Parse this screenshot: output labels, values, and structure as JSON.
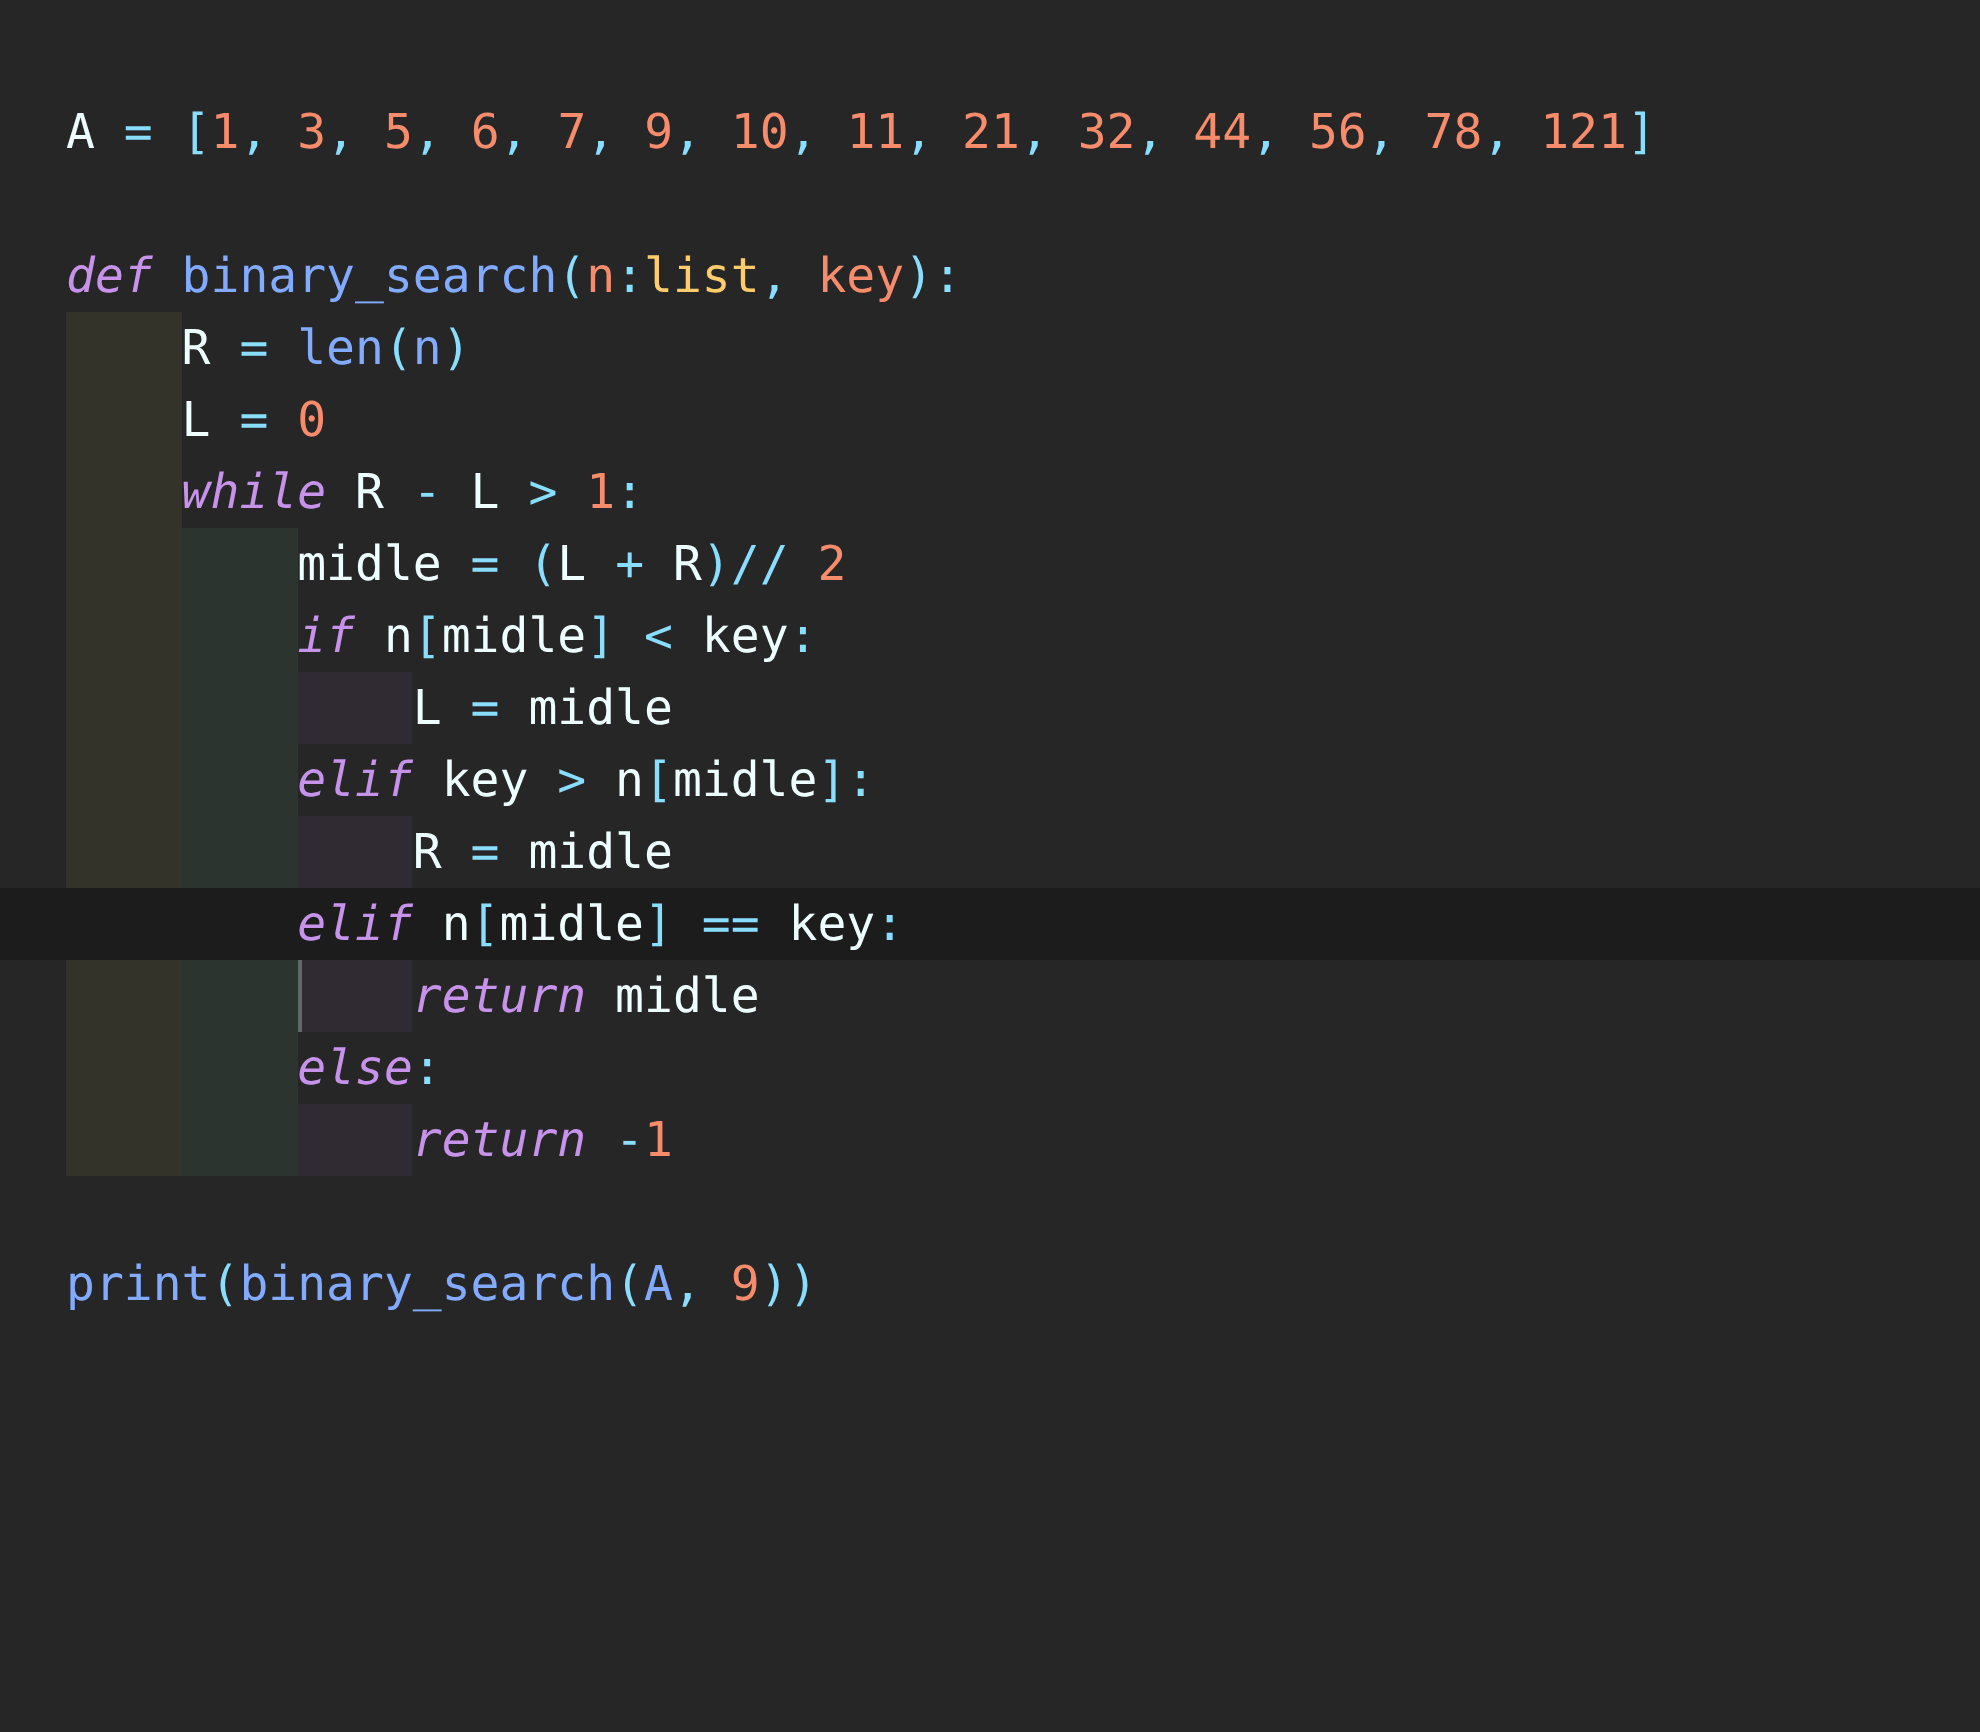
{
  "editor": {
    "lines": [
      {
        "kind": "code",
        "tokens": [
          {
            "t": "A",
            "kind": "plain"
          },
          {
            "t": " = ",
            "kind": "punc"
          },
          {
            "t": "[",
            "kind": "punc"
          },
          {
            "t": "1",
            "kind": "num"
          },
          {
            "t": ", ",
            "kind": "punc"
          },
          {
            "t": "3",
            "kind": "num"
          },
          {
            "t": ", ",
            "kind": "punc"
          },
          {
            "t": "5",
            "kind": "num"
          },
          {
            "t": ", ",
            "kind": "punc"
          },
          {
            "t": "6",
            "kind": "num"
          },
          {
            "t": ", ",
            "kind": "punc"
          },
          {
            "t": "7",
            "kind": "num"
          },
          {
            "t": ", ",
            "kind": "punc"
          },
          {
            "t": "9",
            "kind": "num"
          },
          {
            "t": ", ",
            "kind": "punc"
          },
          {
            "t": "10",
            "kind": "num"
          },
          {
            "t": ", ",
            "kind": "punc"
          },
          {
            "t": "11",
            "kind": "num"
          },
          {
            "t": ", ",
            "kind": "punc"
          },
          {
            "t": "21",
            "kind": "num"
          },
          {
            "t": ", ",
            "kind": "punc"
          },
          {
            "t": "32",
            "kind": "num"
          },
          {
            "t": ", ",
            "kind": "punc"
          },
          {
            "t": "44",
            "kind": "num"
          },
          {
            "t": ", ",
            "kind": "punc"
          },
          {
            "t": "56",
            "kind": "num"
          },
          {
            "t": ", ",
            "kind": "punc"
          },
          {
            "t": "78",
            "kind": "num"
          },
          {
            "t": ", ",
            "kind": "punc"
          },
          {
            "t": "121",
            "kind": "num"
          },
          {
            "t": "]",
            "kind": "punc"
          }
        ]
      },
      {
        "kind": "blank"
      },
      {
        "kind": "code",
        "tokens": [
          {
            "t": "def",
            "kind": "kw"
          },
          {
            "t": " binary_search",
            "kind": "fn"
          },
          {
            "t": "(",
            "kind": "punc"
          },
          {
            "t": "n",
            "kind": "param"
          },
          {
            "t": ":",
            "kind": "punc"
          },
          {
            "t": "list",
            "kind": "type"
          },
          {
            "t": ", ",
            "kind": "punc"
          },
          {
            "t": "key",
            "kind": "param"
          },
          {
            "t": "):",
            "kind": "punc"
          }
        ],
        "children": [
          {
            "kind": "code",
            "tokens": [
              {
                "t": "R",
                "kind": "plain"
              },
              {
                "t": " = ",
                "kind": "punc"
              },
              {
                "t": "len",
                "kind": "fn"
              },
              {
                "t": "(",
                "kind": "punc"
              },
              {
                "t": "n",
                "kind": "fn"
              },
              {
                "t": ")",
                "kind": "punc"
              }
            ]
          },
          {
            "kind": "code",
            "tokens": [
              {
                "t": "L",
                "kind": "plain"
              },
              {
                "t": " = ",
                "kind": "punc"
              },
              {
                "t": "0",
                "kind": "num"
              }
            ]
          },
          {
            "kind": "code",
            "tokens": [
              {
                "t": "while",
                "kind": "kw"
              },
              {
                "t": " R ",
                "kind": "plain"
              },
              {
                "t": "-",
                "kind": "punc"
              },
              {
                "t": " L ",
                "kind": "plain"
              },
              {
                "t": "> ",
                "kind": "punc"
              },
              {
                "t": "1",
                "kind": "num"
              },
              {
                "t": ":",
                "kind": "punc"
              }
            ],
            "children": [
              {
                "kind": "code",
                "tokens": [
                  {
                    "t": "midle",
                    "kind": "plain"
                  },
                  {
                    "t": " = ",
                    "kind": "punc"
                  },
                  {
                    "t": "(",
                    "kind": "punc"
                  },
                  {
                    "t": "L ",
                    "kind": "plain"
                  },
                  {
                    "t": "+",
                    "kind": "punc"
                  },
                  {
                    "t": " R",
                    "kind": "plain"
                  },
                  {
                    "t": ")// ",
                    "kind": "punc"
                  },
                  {
                    "t": "2",
                    "kind": "num"
                  }
                ]
              },
              {
                "kind": "code",
                "tokens": [
                  {
                    "t": "if",
                    "kind": "kw"
                  },
                  {
                    "t": " n",
                    "kind": "plain"
                  },
                  {
                    "t": "[",
                    "kind": "punc"
                  },
                  {
                    "t": "midle",
                    "kind": "plain"
                  },
                  {
                    "t": "]",
                    "kind": "punc"
                  },
                  {
                    "t": " < ",
                    "kind": "punc"
                  },
                  {
                    "t": "key",
                    "kind": "plain"
                  },
                  {
                    "t": ":",
                    "kind": "punc"
                  }
                ],
                "children": [
                  {
                    "kind": "code",
                    "tokens": [
                      {
                        "t": "L",
                        "kind": "plain"
                      },
                      {
                        "t": " = ",
                        "kind": "punc"
                      },
                      {
                        "t": "midle",
                        "kind": "plain"
                      }
                    ]
                  }
                ]
              },
              {
                "kind": "code",
                "tokens": [
                  {
                    "t": "elif",
                    "kind": "kw"
                  },
                  {
                    "t": " key ",
                    "kind": "plain"
                  },
                  {
                    "t": ">",
                    "kind": "punc"
                  },
                  {
                    "t": " n",
                    "kind": "plain"
                  },
                  {
                    "t": "[",
                    "kind": "punc"
                  },
                  {
                    "t": "midle",
                    "kind": "plain"
                  },
                  {
                    "t": "]:",
                    "kind": "punc"
                  }
                ],
                "children": [
                  {
                    "kind": "code",
                    "tokens": [
                      {
                        "t": "R",
                        "kind": "plain"
                      },
                      {
                        "t": " = ",
                        "kind": "punc"
                      },
                      {
                        "t": "midle",
                        "kind": "plain"
                      }
                    ]
                  }
                ]
              },
              {
                "kind": "code",
                "current": true,
                "tokens": [
                  {
                    "t": "elif",
                    "kind": "kw"
                  },
                  {
                    "t": " n",
                    "kind": "plain"
                  },
                  {
                    "t": "[",
                    "kind": "punc"
                  },
                  {
                    "t": "midle",
                    "kind": "plain"
                  },
                  {
                    "t": "]",
                    "kind": "punc"
                  },
                  {
                    "t": " == ",
                    "kind": "punc"
                  },
                  {
                    "t": "key",
                    "kind": "plain"
                  },
                  {
                    "t": ":",
                    "kind": "punc"
                  }
                ],
                "children": [
                  {
                    "kind": "code",
                    "tokens": [
                      {
                        "t": "return",
                        "kind": "kw"
                      },
                      {
                        "t": " midle",
                        "kind": "plain"
                      }
                    ]
                  }
                ]
              },
              {
                "kind": "code",
                "tokens": [
                  {
                    "t": "else",
                    "kind": "kw"
                  },
                  {
                    "t": ":",
                    "kind": "punc"
                  }
                ],
                "children": [
                  {
                    "kind": "code",
                    "tokens": [
                      {
                        "t": "return",
                        "kind": "kw"
                      },
                      {
                        "t": " -",
                        "kind": "punc"
                      },
                      {
                        "t": "1",
                        "kind": "num"
                      }
                    ]
                  }
                ]
              }
            ]
          }
        ]
      },
      {
        "kind": "blank"
      },
      {
        "kind": "code",
        "tokens": [
          {
            "t": "print",
            "kind": "fn"
          },
          {
            "t": "(",
            "kind": "punc"
          },
          {
            "t": "binary_search",
            "kind": "fn"
          },
          {
            "t": "(",
            "kind": "punc"
          },
          {
            "t": "A",
            "kind": "fn"
          },
          {
            "t": ", ",
            "kind": "punc"
          },
          {
            "t": "9",
            "kind": "num"
          },
          {
            "t": "))",
            "kind": "punc"
          }
        ]
      }
    ]
  }
}
